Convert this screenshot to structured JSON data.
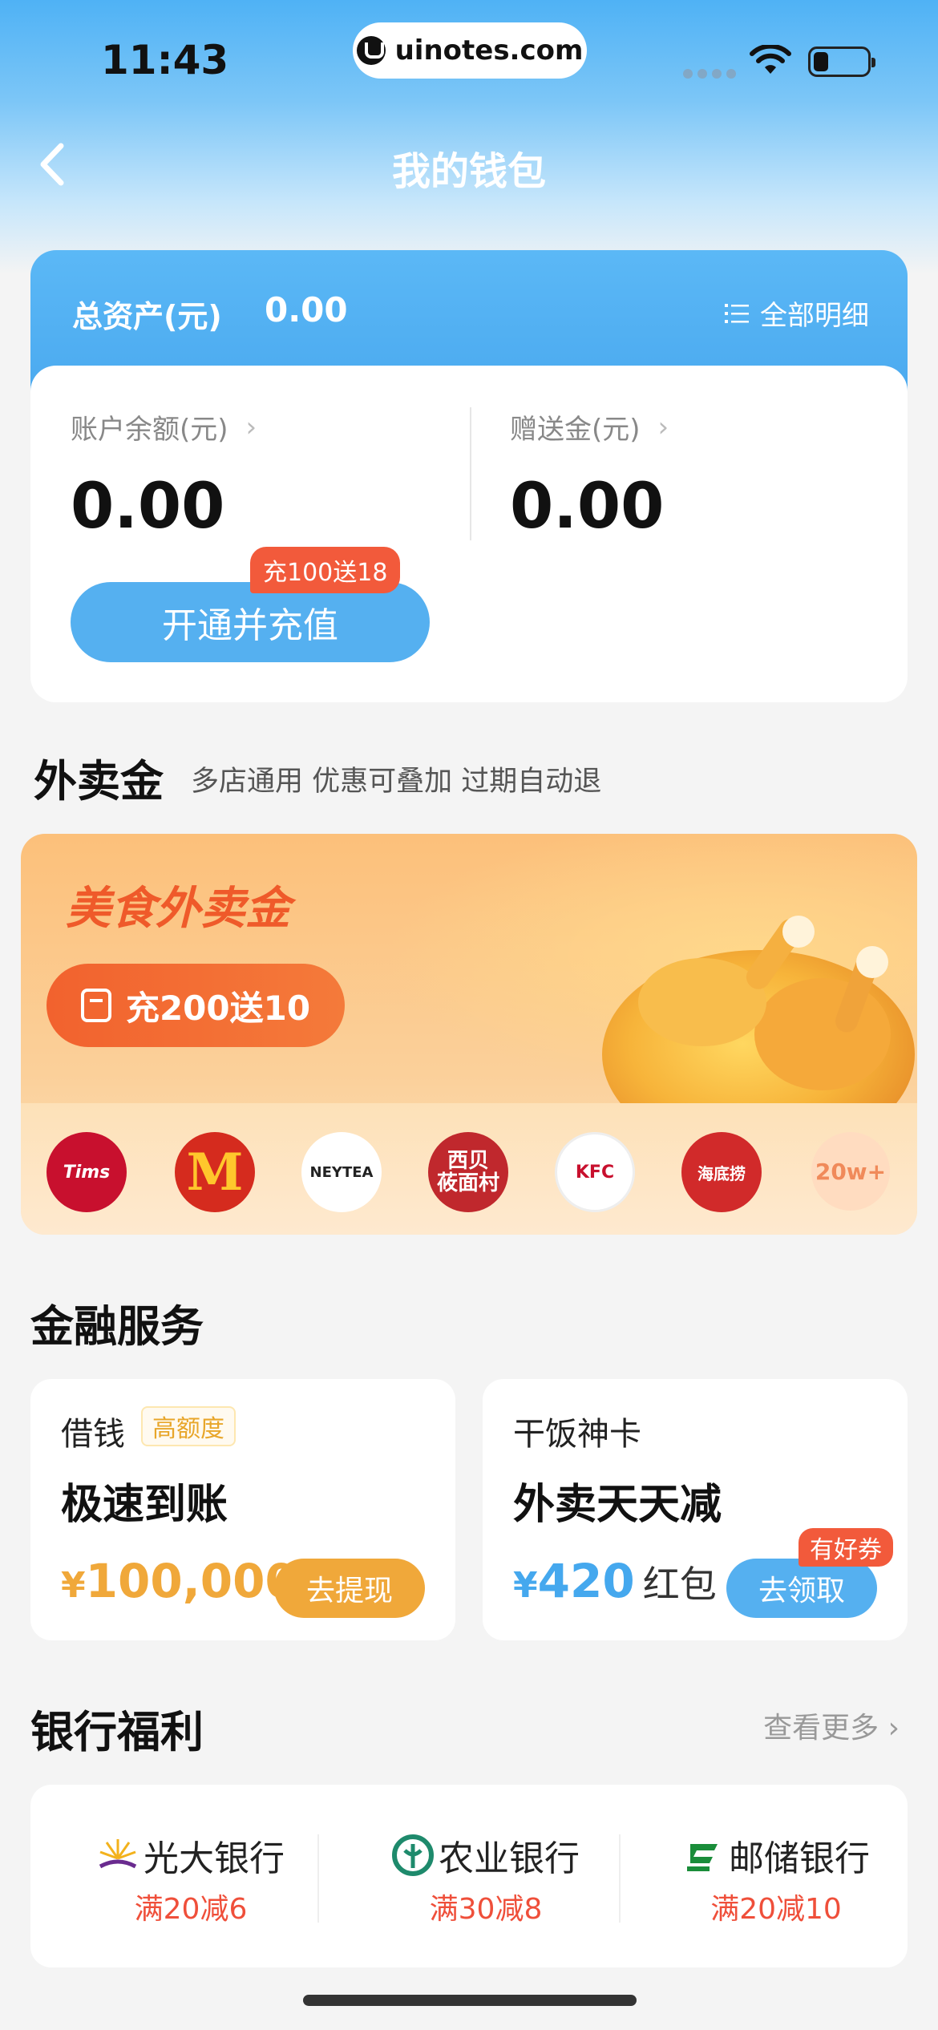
{
  "status_bar": {
    "time": "11:43",
    "url": "uinotes.com"
  },
  "nav": {
    "title": "我的钱包"
  },
  "assets": {
    "total_label": "总资产(元)",
    "total_value": "0.00",
    "detail_label": "全部明细",
    "balance_label": "账户余额(元)",
    "balance_value": "0.00",
    "gift_label": "赠送金(元)",
    "gift_value": "0.00",
    "recharge_button": "开通并充值",
    "recharge_badge": "充100送18"
  },
  "takeout": {
    "title": "外卖金",
    "subtitle": "多店通用 优惠可叠加 过期自动退",
    "card_title": "美食外卖金",
    "card_button": "充200送10",
    "brands": [
      {
        "name": "Tims"
      },
      {
        "name": "M"
      },
      {
        "name": "NEYTEA"
      },
      {
        "name": "西贝\n莜面村"
      },
      {
        "name": "KFC"
      },
      {
        "name": "海底捞"
      }
    ],
    "more_label": "20w+"
  },
  "finance": {
    "title": "金融服务",
    "loan": {
      "name": "借钱",
      "tag": "高额度",
      "headline": "极速到账",
      "currency": "¥",
      "amount": "100,000",
      "button": "去提现"
    },
    "card": {
      "name": "干饭神卡",
      "headline": "外卖天天减",
      "currency": "¥",
      "amount": "420",
      "unit": "红包",
      "button": "去领取",
      "badge": "有好券"
    }
  },
  "bank": {
    "title": "银行福利",
    "more": "查看更多 ›",
    "items": [
      {
        "name": "光大银行",
        "offer": "满20减6"
      },
      {
        "name": "农业银行",
        "offer": "满30减8"
      },
      {
        "name": "邮储银行",
        "offer": "满20减10"
      }
    ]
  },
  "colors": {
    "primary_blue": "#55b0f0",
    "accent_red": "#f25a3b",
    "gold": "#f0a83a",
    "takeout_orange": "#ef5a2a"
  }
}
